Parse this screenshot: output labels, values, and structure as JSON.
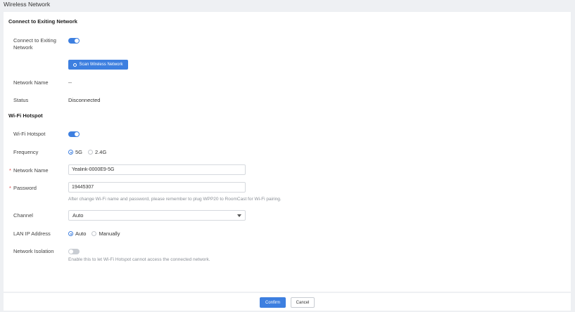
{
  "page": {
    "title": "Wireless Network"
  },
  "connect": {
    "section_title": "Connect to Exiting Network",
    "toggle_label": "Connect to Exiting Network",
    "toggle_on": true,
    "scan_button": "Scan Wireless Network",
    "network_name_label": "Network Name",
    "network_name_value": "--",
    "status_label": "Status",
    "status_value": "Disconnected"
  },
  "hotspot": {
    "section_title": "Wi-Fi Hotspot",
    "toggle_label": "Wi-Fi Hotspot",
    "toggle_on": true,
    "frequency_label": "Frequency",
    "frequency_options": [
      "5G",
      "2.4G"
    ],
    "frequency_selected": "5G",
    "network_name_label": "Network Name",
    "network_name_value": "Yealink-0000E9-5G",
    "password_label": "Password",
    "password_value": "19445307",
    "password_hint": "After change Wi-Fi name and password, please remember to plug WPP20 to RoomCast for Wi-Fi pairing.",
    "channel_label": "Channel",
    "channel_value": "Auto",
    "lan_ip_label": "LAN IP Address",
    "lan_ip_options": [
      "Auto",
      "Manually"
    ],
    "lan_ip_selected": "Auto",
    "isolation_label": "Network Isolation",
    "isolation_on": false,
    "isolation_hint": "Enable this to let Wi-Fi Hotspot cannot access the connected network.",
    "required_mark": "*"
  },
  "footer": {
    "confirm": "Confirm",
    "cancel": "Cancel"
  },
  "colors": {
    "accent": "#3d7fe0",
    "required": "#e04040"
  },
  "icons": {
    "scan": "search-icon",
    "channel_caret": "chevron-down-icon"
  }
}
